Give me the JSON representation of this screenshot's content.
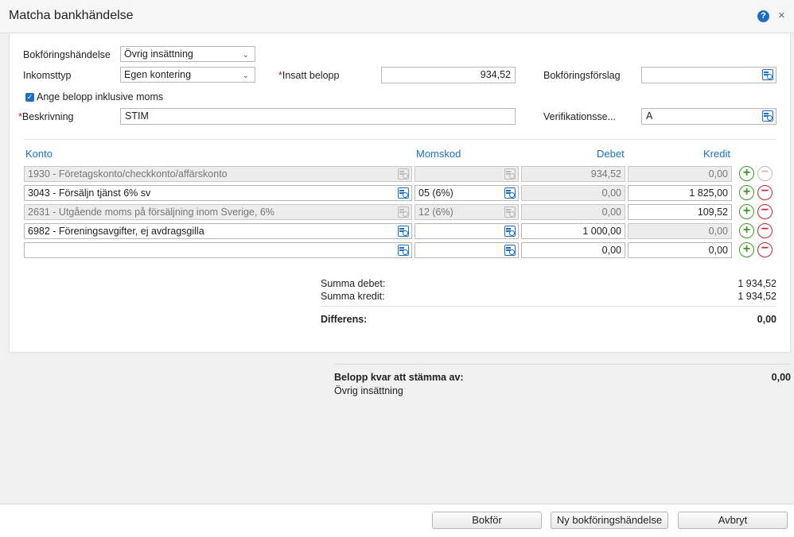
{
  "dialog": {
    "title": "Matcha bankhändelse",
    "help": "?",
    "close": "×"
  },
  "form": {
    "bokforingshandelse_label": "Bokföringshändelse",
    "bokforingshandelse_value": "Övrig insättning",
    "inkomsttyp_label": "Inkomsttyp",
    "inkomsttyp_value": "Egen kontering",
    "required_mark": "*",
    "insatt_belopp_label": "Insatt belopp",
    "insatt_belopp_value": "934,52",
    "bokforingsforslag_label": "Bokföringsförslag",
    "bokforingsforslag_value": "",
    "moms_checkbox_label": "Ange belopp inklusive moms",
    "moms_checkbox_checked": true,
    "beskrivning_label": "Beskrivning",
    "beskrivning_value": "STIM",
    "verifikation_label": "Verifikationsse...",
    "verifikation_value": "A"
  },
  "table": {
    "headers": {
      "konto": "Konto",
      "momskod": "Momskod",
      "debet": "Debet",
      "kredit": "Kredit"
    },
    "rows": [
      {
        "konto": "1930 - Företagskonto/checkkonto/affärskonto",
        "momskod": "",
        "debet": "934,52",
        "kredit": "0,00"
      },
      {
        "konto": "3043 - Försäljn tjänst 6% sv",
        "momskod": "05 (6%)",
        "debet": "0,00",
        "kredit": "1 825,00"
      },
      {
        "konto": "2631 - Utgående moms på försäljning inom Sverige, 6%",
        "momskod": "12 (6%)",
        "debet": "0,00",
        "kredit": "109,52"
      },
      {
        "konto": "6982 - Föreningsavgifter, ej avdragsgilla",
        "momskod": "",
        "debet": "1 000,00",
        "kredit": "0,00"
      },
      {
        "konto": "",
        "momskod": "",
        "debet": "0,00",
        "kredit": "0,00"
      }
    ]
  },
  "summary": {
    "summa_debet_label": "Summa debet:",
    "summa_debet_value": "1 934,52",
    "summa_kredit_label": "Summa kredit:",
    "summa_kredit_value": "1 934,52",
    "differens_label": "Differens:",
    "differens_value": "0,00"
  },
  "remaining": {
    "label": "Belopp kvar att stämma av:",
    "value": "0,00",
    "type": "Övrig insättning"
  },
  "footer": {
    "bokfor": "Bokför",
    "ny": "Ny bokföringshändelse",
    "avbryt": "Avbryt"
  },
  "colors": {
    "accent": "#1a6fc4",
    "required": "#c8102e",
    "add": "#3a9a20",
    "remove": "#d0202a"
  },
  "icons": {
    "lookup": "lookup-icon",
    "help": "help-icon",
    "close": "close-icon",
    "add": "plus-circle-icon",
    "remove": "minus-circle-icon",
    "dropdown": "chevron-down-icon"
  }
}
